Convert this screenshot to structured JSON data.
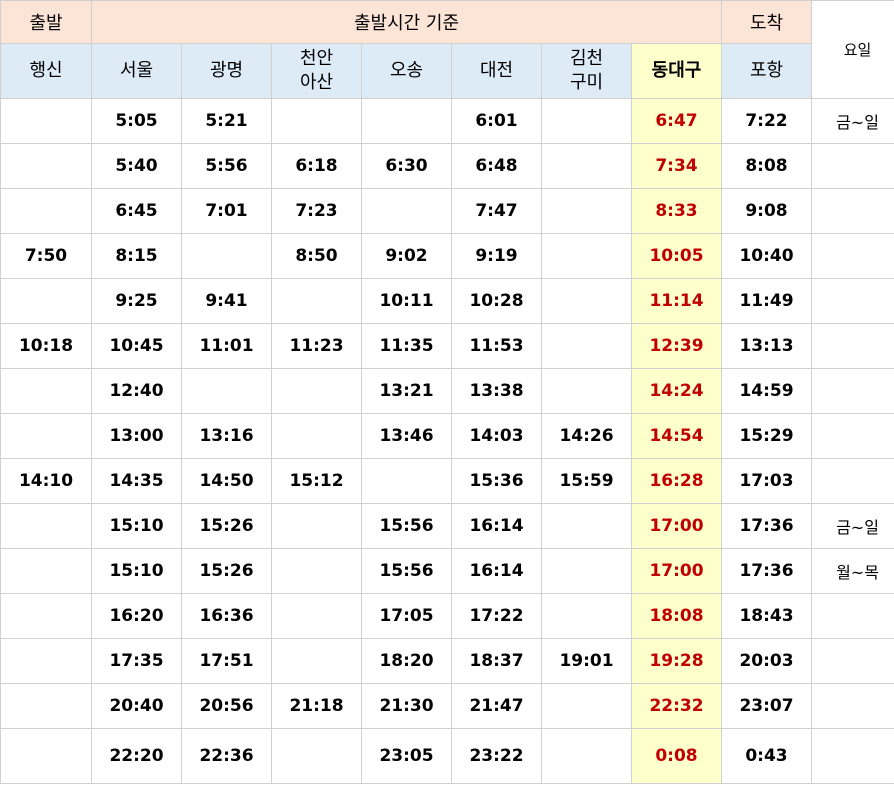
{
  "header": {
    "departure": "출발",
    "basis": "출발시간 기준",
    "arrival": "도착",
    "day_of_week": "요일"
  },
  "stations": {
    "haengsin": "행신",
    "seoul": "서울",
    "gwangmyeong": "광명",
    "cheonan_line1": "천안",
    "cheonan_line2": "아산",
    "osong": "오송",
    "daejeon": "대전",
    "gimcheon_line1": "김천",
    "gimcheon_line2": "구미",
    "dongdaegu": "동대구",
    "pohang": "포항"
  },
  "colors": {
    "header_peach": "#fce4d6",
    "header_blue": "#ddebf7",
    "highlight_yellow": "#ffffcc",
    "highlight_text_red": "#c00000"
  },
  "rows": [
    {
      "haengsin": "",
      "seoul": "5:05",
      "gwangmyeong": "5:21",
      "cheonan": "",
      "osong": "",
      "daejeon": "6:01",
      "gimcheon": "",
      "dongdaegu": "6:47",
      "pohang": "7:22",
      "day": "금~일"
    },
    {
      "haengsin": "",
      "seoul": "5:40",
      "gwangmyeong": "5:56",
      "cheonan": "6:18",
      "osong": "6:30",
      "daejeon": "6:48",
      "gimcheon": "",
      "dongdaegu": "7:34",
      "pohang": "8:08",
      "day": ""
    },
    {
      "haengsin": "",
      "seoul": "6:45",
      "gwangmyeong": "7:01",
      "cheonan": "7:23",
      "osong": "",
      "daejeon": "7:47",
      "gimcheon": "",
      "dongdaegu": "8:33",
      "pohang": "9:08",
      "day": ""
    },
    {
      "haengsin": "7:50",
      "seoul": "8:15",
      "gwangmyeong": "",
      "cheonan": "8:50",
      "osong": "9:02",
      "daejeon": "9:19",
      "gimcheon": "",
      "dongdaegu": "10:05",
      "pohang": "10:40",
      "day": ""
    },
    {
      "haengsin": "",
      "seoul": "9:25",
      "gwangmyeong": "9:41",
      "cheonan": "",
      "osong": "10:11",
      "daejeon": "10:28",
      "gimcheon": "",
      "dongdaegu": "11:14",
      "pohang": "11:49",
      "day": ""
    },
    {
      "haengsin": "10:18",
      "seoul": "10:45",
      "gwangmyeong": "11:01",
      "cheonan": "11:23",
      "osong": "11:35",
      "daejeon": "11:53",
      "gimcheon": "",
      "dongdaegu": "12:39",
      "pohang": "13:13",
      "day": ""
    },
    {
      "haengsin": "",
      "seoul": "12:40",
      "gwangmyeong": "",
      "cheonan": "",
      "osong": "13:21",
      "daejeon": "13:38",
      "gimcheon": "",
      "dongdaegu": "14:24",
      "pohang": "14:59",
      "day": ""
    },
    {
      "haengsin": "",
      "seoul": "13:00",
      "gwangmyeong": "13:16",
      "cheonan": "",
      "osong": "13:46",
      "daejeon": "14:03",
      "gimcheon": "14:26",
      "dongdaegu": "14:54",
      "pohang": "15:29",
      "day": ""
    },
    {
      "haengsin": "14:10",
      "seoul": "14:35",
      "gwangmyeong": "14:50",
      "cheonan": "15:12",
      "osong": "",
      "daejeon": "15:36",
      "gimcheon": "15:59",
      "dongdaegu": "16:28",
      "pohang": "17:03",
      "day": ""
    },
    {
      "haengsin": "",
      "seoul": "15:10",
      "gwangmyeong": "15:26",
      "cheonan": "",
      "osong": "15:56",
      "daejeon": "16:14",
      "gimcheon": "",
      "dongdaegu": "17:00",
      "pohang": "17:36",
      "day": "금~일"
    },
    {
      "haengsin": "",
      "seoul": "15:10",
      "gwangmyeong": "15:26",
      "cheonan": "",
      "osong": "15:56",
      "daejeon": "16:14",
      "gimcheon": "",
      "dongdaegu": "17:00",
      "pohang": "17:36",
      "day": "월~목"
    },
    {
      "haengsin": "",
      "seoul": "16:20",
      "gwangmyeong": "16:36",
      "cheonan": "",
      "osong": "17:05",
      "daejeon": "17:22",
      "gimcheon": "",
      "dongdaegu": "18:08",
      "pohang": "18:43",
      "day": ""
    },
    {
      "haengsin": "",
      "seoul": "17:35",
      "gwangmyeong": "17:51",
      "cheonan": "",
      "osong": "18:20",
      "daejeon": "18:37",
      "gimcheon": "19:01",
      "dongdaegu": "19:28",
      "pohang": "20:03",
      "day": ""
    },
    {
      "haengsin": "",
      "seoul": "20:40",
      "gwangmyeong": "20:56",
      "cheonan": "21:18",
      "osong": "21:30",
      "daejeon": "21:47",
      "gimcheon": "",
      "dongdaegu": "22:32",
      "pohang": "23:07",
      "day": ""
    },
    {
      "haengsin": "",
      "seoul": "22:20",
      "gwangmyeong": "22:36",
      "cheonan": "",
      "osong": "23:05",
      "daejeon": "23:22",
      "gimcheon": "",
      "dongdaegu": "0:08",
      "pohang": "0:43",
      "day": ""
    }
  ]
}
